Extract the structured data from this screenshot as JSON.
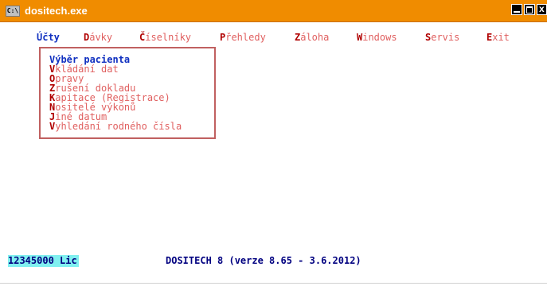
{
  "window": {
    "title": "dositech.exe",
    "icon": "cmd-icon",
    "icon_text": "C:\\"
  },
  "menu": [
    {
      "hot": "Ú",
      "rest": "čty",
      "active": true
    },
    {
      "hot": "D",
      "rest": "ávky"
    },
    {
      "hot": "Č",
      "rest": "íselníky"
    },
    {
      "hot": "P",
      "rest": "řehledy"
    },
    {
      "hot": "Z",
      "rest": "áloha"
    },
    {
      "hot": "W",
      "rest": "indows"
    },
    {
      "hot": "S",
      "rest": "ervis"
    },
    {
      "hot": "E",
      "rest": "xit"
    }
  ],
  "dropdown": [
    {
      "hot": "V",
      "rest": "ýběr pacienta",
      "selected": true
    },
    {
      "hot": "V",
      "rest": "kládání dat"
    },
    {
      "hot": "O",
      "rest": "pravy"
    },
    {
      "hot": "Z",
      "rest": "rušení dokladu"
    },
    {
      "hot": "K",
      "rest": "apitace (Registrace)"
    },
    {
      "hot": "N",
      "rest": "ositelé výkonů"
    },
    {
      "hot": "J",
      "rest": "iné datum"
    },
    {
      "hot": "V",
      "rest": "yhledání rodného čísla"
    }
  ],
  "status": {
    "license": "12345000 Lic",
    "version": "DOSITECH 8 (verze 8.65 - 3.6.2012)"
  }
}
